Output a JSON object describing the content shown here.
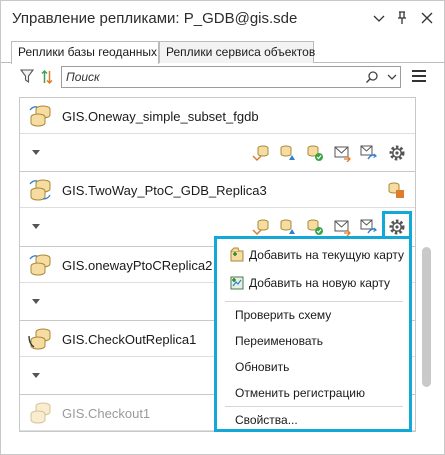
{
  "window": {
    "title": "Управление репликами: P_GDB@gis.sde"
  },
  "tabs": [
    {
      "label": "Реплики базы геоданных",
      "active": true
    },
    {
      "label": "Реплики сервиса объектов",
      "active": false
    }
  ],
  "search": {
    "placeholder": "Поиск"
  },
  "replicas": [
    {
      "name": "GIS.Oneway_simple_subset_fgdb",
      "icon": "database-sync-icon",
      "status": "normal"
    },
    {
      "name": "GIS.TwoWay_PtoC_GDB_Replica3",
      "icon": "database-twoway-icon",
      "status": "normal"
    },
    {
      "name": "GIS.onewayPtoCReplica2",
      "icon": "database-sync-icon",
      "status": "normal"
    },
    {
      "name": "GIS.CheckOutReplica1",
      "icon": "database-checkout-icon",
      "status": "normal"
    },
    {
      "name": "GIS.Checkout1",
      "icon": "database-icon",
      "status": "disabled"
    }
  ],
  "context_menu": {
    "items": [
      {
        "label": "Добавить на текущую карту",
        "icon": "add-to-current-map-icon"
      },
      {
        "label": "Добавить на новую карту",
        "icon": "add-to-new-map-icon"
      },
      {
        "label": "Проверить схему"
      },
      {
        "label": "Переименовать"
      },
      {
        "label": "Обновить"
      },
      {
        "label": "Отменить регистрацию"
      },
      {
        "label": "Свойства..."
      }
    ]
  },
  "colors": {
    "highlight": "#12a9d8",
    "db_yellow": "#e8b84a",
    "arrow_blue": "#2f7fd1",
    "check_green": "#3da34a",
    "orange": "#e07b2a"
  }
}
